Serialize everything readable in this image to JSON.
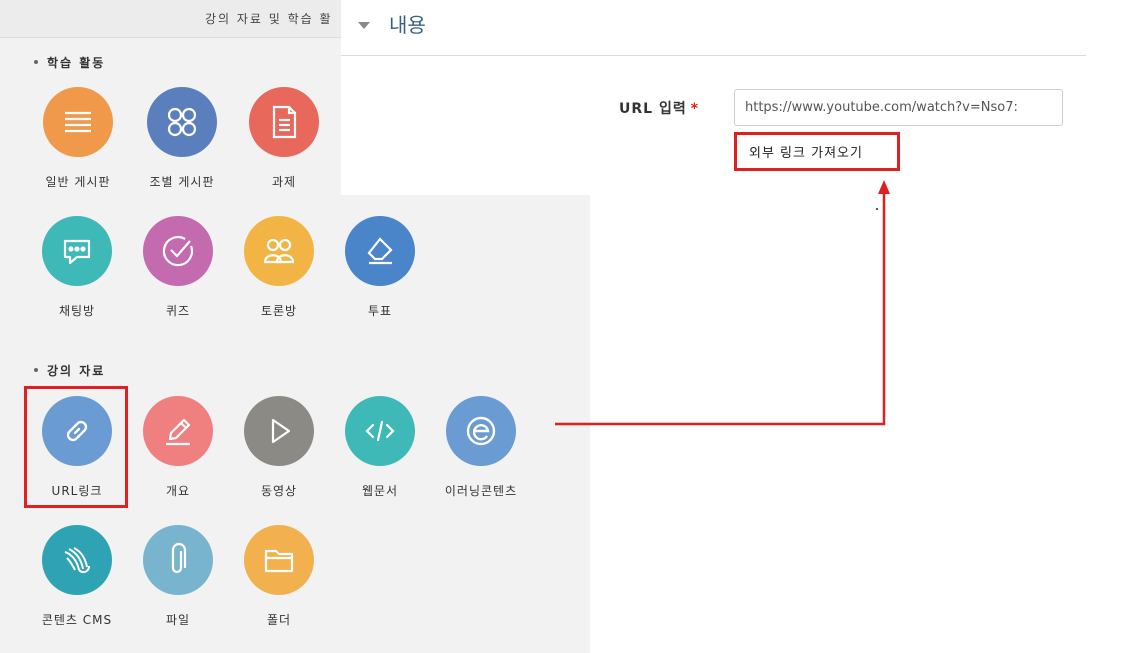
{
  "panel": {
    "header": "강의 자료 및 학습 활",
    "sections": [
      {
        "title": "학습 활동",
        "items": [
          {
            "label": "일반 게시판",
            "icon": "list-icon",
            "color": "#f0994a"
          },
          {
            "label": "조별 게시판",
            "icon": "group-board-icon",
            "color": "#5b7fbd"
          },
          {
            "label": "과제",
            "icon": "document-icon",
            "color": "#e8685c"
          },
          {
            "label": "채팅방",
            "icon": "chat-icon",
            "color": "#3fb8b8"
          },
          {
            "label": "퀴즈",
            "icon": "check-icon",
            "color": "#c46aae"
          },
          {
            "label": "토론방",
            "icon": "people-icon",
            "color": "#f2b445"
          },
          {
            "label": "투표",
            "icon": "eraser-icon",
            "color": "#4a84c9"
          }
        ]
      },
      {
        "title": "강의 자료",
        "items": [
          {
            "label": "URL링크",
            "icon": "link-icon",
            "color": "#6a9bd2"
          },
          {
            "label": "개요",
            "icon": "pencil-icon",
            "color": "#f07f7f"
          },
          {
            "label": "동영상",
            "icon": "play-icon",
            "color": "#8c8a84"
          },
          {
            "label": "웹문서",
            "icon": "code-icon",
            "color": "#3fb8b8"
          },
          {
            "label": "이러닝콘텐츠",
            "icon": "elearning-icon",
            "color": "#6a9bd2"
          },
          {
            "label": "콘텐츠 CMS",
            "icon": "cms-icon",
            "color": "#2ea3b3"
          },
          {
            "label": "파일",
            "icon": "paperclip-icon",
            "color": "#79b4cf"
          },
          {
            "label": "폴더",
            "icon": "folder-icon",
            "color": "#f2b04e"
          }
        ]
      }
    ]
  },
  "content": {
    "heading": "내용",
    "url_label": "URL 입력",
    "required_mark": "*",
    "url_value": "https://www.youtube.com/watch?v=Nso7:",
    "import_button": "외부 링크 가져오기"
  },
  "colors": {
    "highlight": "#e02020",
    "heading": "#3a5f86"
  }
}
